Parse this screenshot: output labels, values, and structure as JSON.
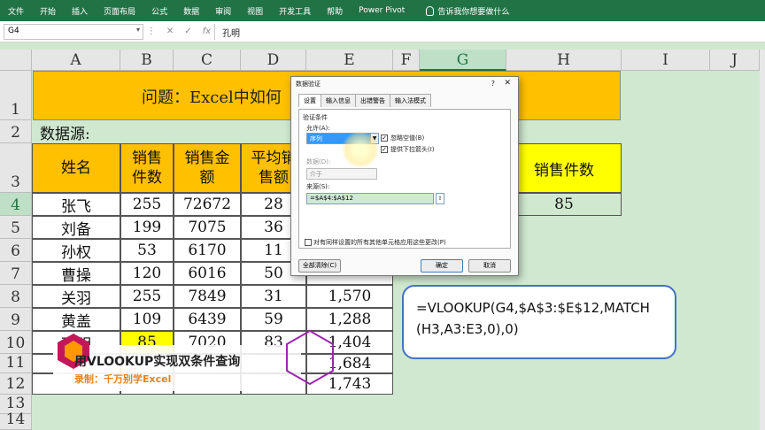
{
  "ribbon": {
    "tabs": [
      "文件",
      "开始",
      "插入",
      "页面布局",
      "公式",
      "数据",
      "审阅",
      "视图",
      "开发工具",
      "帮助",
      "Power Pivot"
    ],
    "tell_me": "告诉我你想要做什么"
  },
  "formula_bar": {
    "name_box": "G4",
    "icons": [
      "⋮",
      "✕",
      "✓",
      "fx"
    ],
    "content": "孔明"
  },
  "columns": [
    "A",
    "B",
    "C",
    "D",
    "E",
    "F",
    "G",
    "H",
    "I",
    "J"
  ],
  "selected_column": "G",
  "selected_row": "4",
  "rows": [
    "1",
    "2",
    "3",
    "4",
    "5",
    "6",
    "7",
    "8",
    "9",
    "10",
    "11",
    "12",
    "13",
    "14"
  ],
  "sheet": {
    "title": "问题：Excel中如何",
    "source_label": "数据源:",
    "headers": [
      "姓名",
      "销售件数",
      "销售金额",
      "平均销售额",
      "",
      "",
      "",
      "销售件数"
    ],
    "headers_display": {
      "A": "姓名",
      "B": "销售\n件数",
      "C": "销售金\n额",
      "D": "平均销\n售额",
      "H": "销售件数"
    },
    "data_rows": [
      [
        "张飞",
        "255",
        "72672",
        "28",
        ""
      ],
      [
        "刘备",
        "199",
        "7075",
        "36",
        ""
      ],
      [
        "孙权",
        "53",
        "6170",
        "11",
        ""
      ],
      [
        "曹操",
        "120",
        "6016",
        "50",
        ""
      ],
      [
        "关羽",
        "255",
        "7849",
        "31",
        "1,570"
      ],
      [
        "黄盖",
        "109",
        "6439",
        "59",
        "1,288"
      ],
      [
        "孔明",
        "85",
        "7020",
        "83",
        "1,404"
      ],
      [
        "",
        "",
        "",
        "",
        "1,684"
      ],
      [
        "",
        "",
        "",
        "",
        "1,743"
      ]
    ],
    "h4_value": "85"
  },
  "dialog": {
    "title": "数据验证",
    "help": "?",
    "close": "✕",
    "tabs": [
      "设置",
      "输入信息",
      "出错警告",
      "输入法模式"
    ],
    "criteria_label": "验证条件",
    "allow_label": "允许(A):",
    "allow_value": "序列",
    "ignore_blank": "忽略空值(B)",
    "in_cell_dropdown": "提供下拉箭头(I)",
    "data_label": "数据(D):",
    "data_value": "介于",
    "source_label": "来源(S):",
    "source_value": "=$A$4:$A$12",
    "apply_all": "对有同样设置的所有其他单元格应用这些更改(P)",
    "clear_all": "全部清除(C)",
    "ok": "确定",
    "cancel": "取消"
  },
  "callout": {
    "formula": "=VLOOKUP(G4,$A$3:$E$12,MATCH(H3,A3:E3,0),0)"
  },
  "watermark": {
    "title": "用VLOOKUP实现双条件查询",
    "subtitle": "录制：千万别学Excel"
  },
  "colors": {
    "ribbon": "#217346",
    "header_fill": "#ffc000",
    "h3_fill": "#ffff00",
    "b10_fill": "#ffff00",
    "sheet_bg": "#cfe8cf",
    "callout_border": "#4472c4"
  }
}
